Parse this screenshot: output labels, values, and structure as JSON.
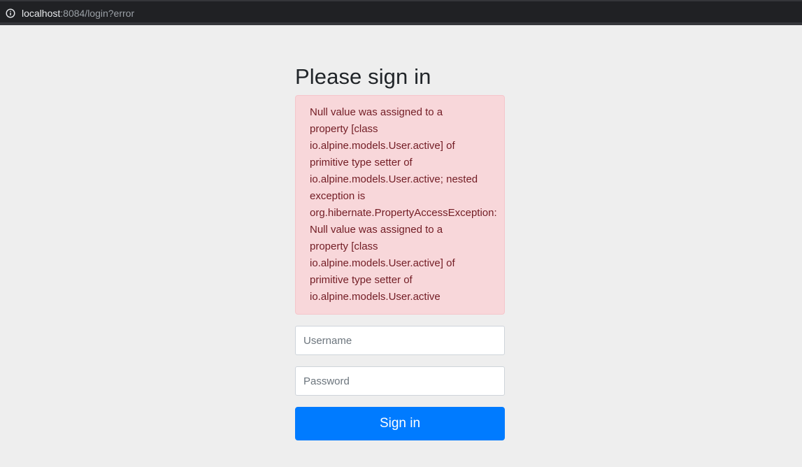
{
  "browser": {
    "url_host": "localhost",
    "url_rest": ":8084/login?error",
    "info_icon": "info-circle-icon"
  },
  "page": {
    "title": "Please sign in",
    "error_message": "Null value was assigned to a\nproperty [class\nio.alpine.models.User.active] of\nprimitive type setter of\nio.alpine.models.User.active; nested\nexception is\norg.hibernate.PropertyAccessException:\nNull value was assigned to a\nproperty [class\nio.alpine.models.User.active] of\nprimitive type setter of\nio.alpine.models.User.active",
    "username_placeholder": "Username",
    "password_placeholder": "Password",
    "signin_label": "Sign in"
  },
  "colors": {
    "background": "#eeeeee",
    "alert_bg": "#f8d7da",
    "alert_text": "#721c24",
    "primary": "#007bff"
  }
}
